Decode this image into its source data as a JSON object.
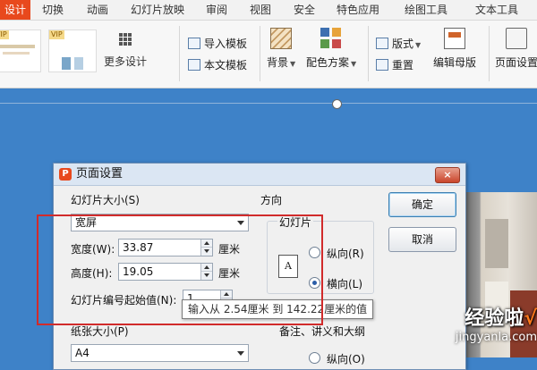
{
  "menubar": {
    "tabs": [
      {
        "label": "设计"
      },
      {
        "label": "切换"
      },
      {
        "label": "动画"
      },
      {
        "label": "幻灯片放映"
      },
      {
        "label": "审阅"
      },
      {
        "label": "视图"
      },
      {
        "label": "安全"
      },
      {
        "label": "特色应用"
      },
      {
        "label": "绘图工具"
      },
      {
        "label": "文本工具"
      }
    ]
  },
  "ribbon": {
    "vip_badge": "VIP",
    "more_design": "更多设计",
    "import_template": "导入模板",
    "body_template": "本文模板",
    "background": "背景",
    "color_scheme": "配色方案",
    "layout": "版式",
    "reset": "重置",
    "edit_master": "编辑母版",
    "page_setup": "页面设置"
  },
  "dialog": {
    "title": "页面设置",
    "close": "×",
    "app_icon": "P",
    "slide_size_label": "幻灯片大小(S)",
    "slide_size_value": "宽屏",
    "width_label": "宽度(W):",
    "width_value": "33.87",
    "width_unit": "厘米",
    "height_label": "高度(H):",
    "height_value": "19.05",
    "height_unit": "厘米",
    "numbering_label": "幻灯片编号起始值(N):",
    "numbering_value": "1",
    "paper_size_label": "纸张大小(P)",
    "paper_size_value": "A4",
    "orientation_label": "方向",
    "slides_group": "幻灯片",
    "orient_icon_letter": "A",
    "portrait_label": "纵向(R)",
    "landscape_label": "横向(L)",
    "notes_group": "备注、讲义和大纲",
    "notes_portrait_label": "纵向(O)",
    "ok": "确定",
    "cancel": "取消"
  },
  "tooltip": "输入从 2.54厘米 到 142.22厘米的值",
  "watermark": {
    "title": "经验啦",
    "check": "√",
    "url": "jingyanla.com"
  },
  "colors": {
    "accent_tab": "#e8491d",
    "workspace": "#3e82c8",
    "highlight_box": "#d12b2b"
  }
}
